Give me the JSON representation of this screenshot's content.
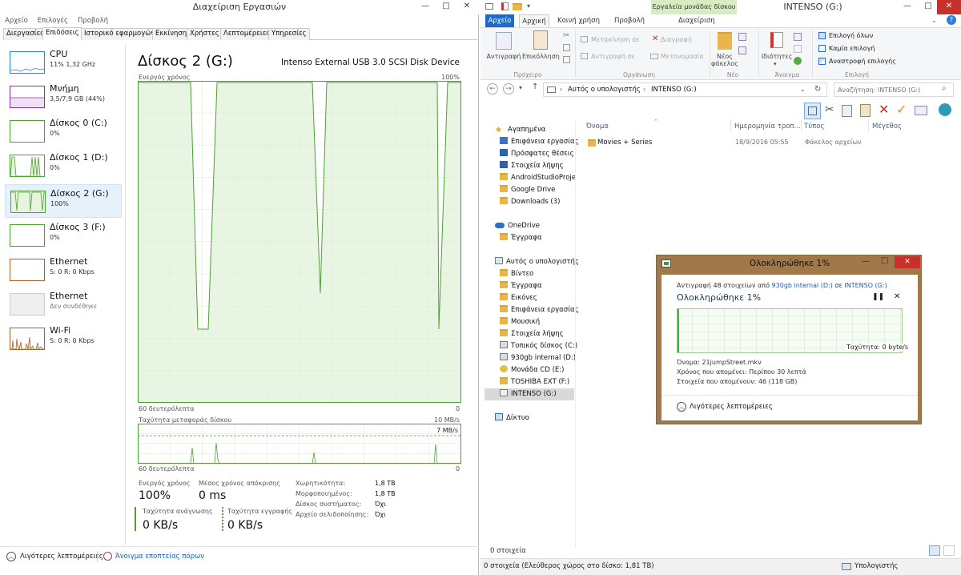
{
  "taskmgr": {
    "title": "Διαχείριση Εργασιών",
    "menu": [
      "Αρχείο",
      "Επιλογές",
      "Προβολή"
    ],
    "tabs": [
      "Διεργασίες",
      "Επιδόσεις",
      "Ιστορικό εφαρμογών",
      "Εκκίνηση",
      "Χρήστες",
      "Λεπτομέρειες",
      "Υπηρεσίες"
    ],
    "sidebar": [
      {
        "name": "CPU",
        "sub": "11% 1,32 GHz",
        "color": "#1c8ad8"
      },
      {
        "name": "Μνήμη",
        "sub": "3,5/7,9 GB (44%)",
        "color": "#8b2fb8"
      },
      {
        "name": "Δίσκος 0 (C:)",
        "sub": "0%",
        "color": "#4da033"
      },
      {
        "name": "Δίσκος 1 (D:)",
        "sub": "0%",
        "color": "#4da033"
      },
      {
        "name": "Δίσκος 2 (G:)",
        "sub": "100%",
        "color": "#4da033"
      },
      {
        "name": "Δίσκος 3 (F:)",
        "sub": "0%",
        "color": "#4da033"
      },
      {
        "name": "Ethernet",
        "sub": "S: 0 R: 0 Kbps",
        "color": "#a7612a"
      },
      {
        "name": "Ethernet",
        "sub": "Δεν συνδέθηκε",
        "color": "#999999"
      },
      {
        "name": "Wi-Fi",
        "sub": "S: 0 R: 0 Kbps",
        "color": "#a7612a"
      }
    ],
    "disk_title": "Δίσκος 2 (G:)",
    "disk_model": "Intenso External USB 3.0 SCSI Disk Device",
    "active_label": "Ενεργός χρόνος",
    "active_max": "100%",
    "seconds_label": "60 δευτερόλεπτα",
    "zero": "0",
    "transfer_label": "Ταχύτητα μεταφοράς δίσκου",
    "transfer_max": "10 MB/s",
    "transfer_marker": "7 MB/s",
    "stats": {
      "active_time_label": "Ενεργός χρόνος",
      "active_time_value": "100%",
      "response_label": "Μέσος χρόνος απόκρισης",
      "response_value": "0 ms",
      "read_label": "Ταχύτητα ανάγνωσης",
      "read_value": "0 KB/s",
      "write_label": "Ταχύτητα εγγραφής",
      "write_value": "0 KB/s",
      "capacity_label": "Χωρητικότητα:",
      "capacity_value": "1,8 TB",
      "formatted_label": "Μορφοποιημένος:",
      "formatted_value": "1,8 TB",
      "system_label": "Δίσκος συστήματος:",
      "system_value": "Όχι",
      "pagefile_label": "Αρχείο σελιδοποίησης:",
      "pagefile_value": "Όχι"
    },
    "fewer_details": "Λιγότερες λεπτομέρειες",
    "open_monitor": "Άνοιγμα εποπτείας πόρων"
  },
  "explorer": {
    "title": "INTENSO (G:)",
    "context_tab": "Εργαλεία μονάδας δίσκου",
    "ribbon_tabs": [
      "Αρχείο",
      "Αρχική",
      "Κοινή χρήση",
      "Προβολή",
      "Διαχείριση"
    ],
    "ribbon": {
      "copy": "Αντιγραφή",
      "paste": "Επικόλληση",
      "move_to": "Μετακίνηση σε",
      "copy_to": "Αντιγραφή σε",
      "delete": "Διαγραφή",
      "rename": "Μετονομασία",
      "new_folder": "Νέος φάκελος",
      "properties": "Ιδιότητες",
      "select_all": "Επιλογή όλων",
      "select_none": "Καμία επιλογή",
      "invert_selection": "Αναστροφή επιλογής",
      "groups": [
        "Πρόχειρο",
        "Οργάνωση",
        "Νέο",
        "Άνοιγμα",
        "Επιλογή"
      ]
    },
    "address": [
      "Αυτός ο υπολογιστής",
      "INTENSO (G:)"
    ],
    "search_placeholder": "Αναζήτηση: INTENSO (G:)",
    "columns": [
      "Όνομα",
      "Ημερομηνία τροπ...",
      "Τύπος",
      "Μέγεθος"
    ],
    "files": [
      {
        "name": "Movies + Series",
        "date": "18/9/2016 05:55",
        "type": "Φάκελος αρχείων",
        "size": ""
      }
    ],
    "nav": {
      "favorites": "Αγαπημένα",
      "fav_items": [
        "Επιφάνεια εργασίας",
        "Πρόσφατες θέσεις",
        "Στοιχεία λήψης",
        "AndroidStudioProje",
        "Google Drive",
        "Downloads (3)"
      ],
      "onedrive": "OneDrive",
      "onedrive_items": [
        "Έγγραφα"
      ],
      "pc": "Αυτός ο υπολογιστής",
      "pc_items": [
        "Βίντεο",
        "Έγγραφα",
        "Εικόνες",
        "Επιφάνεια εργασίας",
        "Μουσική",
        "Στοιχεία λήψης",
        "Τοπικός δίσκος (C:)",
        "930gb internal (D:)",
        "Μονάδα CD (E:)",
        "TOSHIBA EXT (F:)",
        "INTENSO (G:)"
      ],
      "network": "Δίκτυο"
    },
    "status_items": "0 στοιχεία",
    "status_bar": "0 στοιχεία (Ελεύθερος χώρος στο δίσκο: 1,81 TB)",
    "status_computer": "Υπολογιστής"
  },
  "copy_dialog": {
    "title": "Ολοκληρώθηκε 1%",
    "line_prefix": "Αντιγραφή 48 στοιχείων από",
    "src": "930gb internal (D:)",
    "mid": "σε",
    "dst": "INTENSO (G:)",
    "progress_title": "Ολοκληρώθηκε 1%",
    "progress": 0.01,
    "speed": "Ταχύτητα: 0 byte/s",
    "name_label": "Όνομα:",
    "name_value": "21jumpStreet.mkv",
    "time_label": "Χρόνος που απομένει:",
    "time_value": "Περίπου 30 λεπτά",
    "items_label": "Στοιχεία που απομένουν:",
    "items_value": "46 (118 GB)",
    "fewer_details": "Λιγότερες λεπτομέρειες"
  }
}
